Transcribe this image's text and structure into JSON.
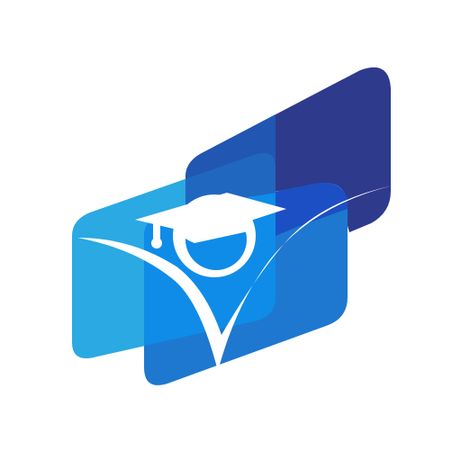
{
  "logo": {
    "icon": "graduate-checkmark-icon",
    "colors": {
      "background": "#ffffff",
      "navy": "#2E3A8C",
      "royal_blue": "#1C4FC4",
      "mid_blue": "#1E78CF",
      "sky_blue": "#2AA9E2",
      "bright_blue": "#0F8CE8",
      "deep_overlap": "#1E5CB8",
      "white": "#ffffff"
    }
  }
}
